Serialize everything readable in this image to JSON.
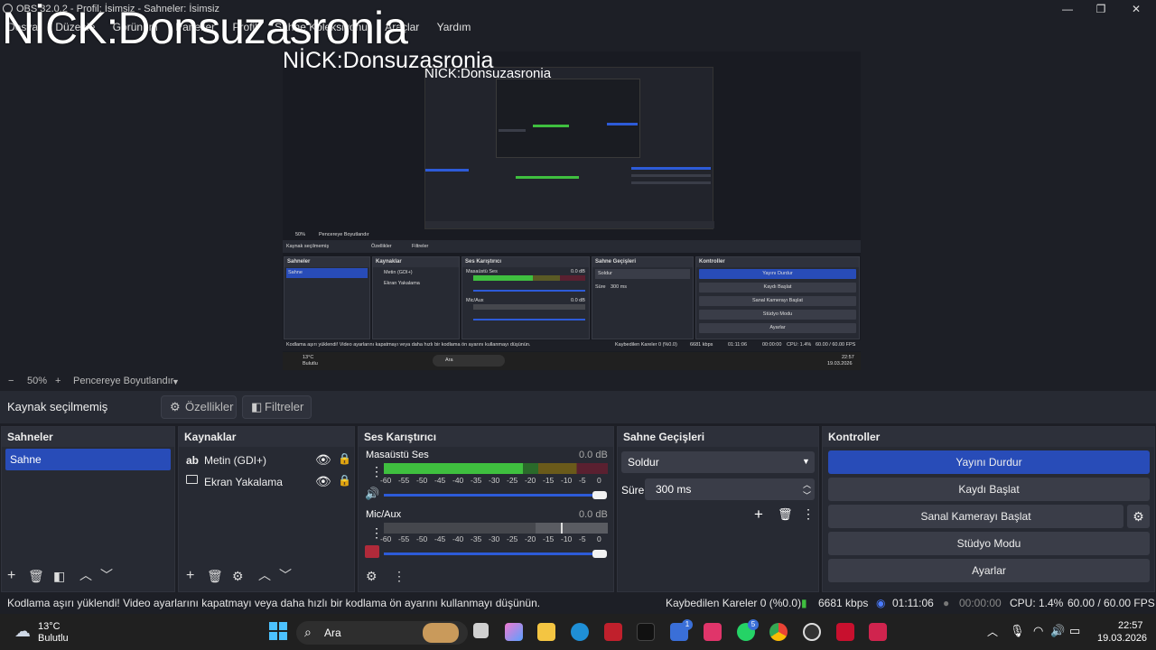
{
  "window": {
    "title": "OBS 32.0.2 - Profil: İsimsiz - Sahneler: İsimsiz",
    "minimize": "—",
    "maximize": "❐",
    "close": "✕"
  },
  "menu": [
    "Dosya",
    "Düzenle",
    "Görünüm",
    "Paneller",
    "Profil",
    "Sahne Koleksiyonu",
    "Araçlar",
    "Yardım"
  ],
  "overlay": {
    "nick": "NİCK:Donsuzasronia"
  },
  "preview": {
    "mini": {
      "zoom": "50%",
      "fit": "Pencereye Boyutlandır",
      "source_status": "Kaynak seçilmemiş",
      "properties": "Özellikler",
      "filters": "Filtreler",
      "scenes": "Sahneler",
      "scene": "Sahne",
      "sources": "Kaynaklar",
      "src1": "Metin (GDI+)",
      "src2": "Ekran Yakalama",
      "mixer": "Ses Karıştırıcı",
      "desktop": "Masaüstü Ses",
      "mic": "Mic/Aux",
      "db": "0.0 dB",
      "transitions": "Sahne Geçişleri",
      "fade": "Soldur",
      "duration_label": "Süre",
      "duration": "300 ms",
      "controls": "Kontroller",
      "b1": "Yayını Durdur",
      "b2": "Kaydı Başlat",
      "b3": "Sanal Kamerayı Başlat",
      "b4": "Stüdyo Modu",
      "b5": "Ayarlar",
      "warning": "Kodlama aşırı yüklendi! Video ayarlarını kapatmayı veya daha hızlı bir kodlama ön ayarını kullanmayı düşünün.",
      "dropped": "Kaybedilen Kareler 0 (%0.0)",
      "kbps": "6681 kbps",
      "time": "01:11:06",
      "rec": "00:00:00",
      "cpu": "CPU: 1.4%",
      "fps": "60.00 / 60.00 FPS",
      "temp": "13°C",
      "weather": "Bulutlu",
      "search": "Ara",
      "clock": "22:57",
      "date": "19.03.2026"
    }
  },
  "zoombar": {
    "minus": "−",
    "zoom": "50%",
    "plus": "+",
    "fit": "Pencereye Boyutlandır"
  },
  "source_toolbar": {
    "status": "Kaynak seçilmemiş",
    "properties": "Özellikler",
    "filters": "Filtreler"
  },
  "scenes": {
    "title": "Sahneler",
    "items": [
      "Sahne"
    ]
  },
  "sources": {
    "title": "Kaynaklar",
    "items": [
      {
        "label": "Metin (GDI+)"
      },
      {
        "label": "Ekran Yakalama"
      }
    ]
  },
  "mixer": {
    "title": "Ses Karıştırıcı",
    "channels": [
      {
        "name": "Masaüstü Ses",
        "db": "0.0 dB",
        "level": 0.62
      },
      {
        "name": "Mic/Aux",
        "db": "0.0 dB",
        "level": 0.0
      }
    ],
    "ticks": [
      "-60",
      "-55",
      "-50",
      "-45",
      "-40",
      "-35",
      "-30",
      "-25",
      "-20",
      "-15",
      "-10",
      "-5",
      "0"
    ]
  },
  "transitions": {
    "title": "Sahne Geçişleri",
    "selected": "Soldur",
    "duration_label": "Süre",
    "duration": "300 ms"
  },
  "controls": {
    "title": "Kontroller",
    "stream": "Yayını Durdur",
    "record": "Kaydı Başlat",
    "virtualcam": "Sanal Kamerayı Başlat",
    "studio": "Stüdyo Modu",
    "settings": "Ayarlar"
  },
  "status": {
    "warning": "Kodlama aşırı yüklendi! Video ayarlarını kapatmayı veya daha hızlı bir kodlama ön ayarını kullanmayı düşünün.",
    "dropped": "Kaybedilen Kareler 0 (%0.0)",
    "kbps": "6681 kbps",
    "stream_time": "01:11:06",
    "rec_time": "00:00:00",
    "cpu": "CPU: 1.4%",
    "fps": "60.00 / 60.00 FPS"
  },
  "taskbar": {
    "temp": "13°C",
    "weather": "Bulutlu",
    "search": "Ara",
    "clock": "22:57",
    "date": "19.03.2026",
    "badge1": "1",
    "badge2": "5"
  },
  "colors": {
    "accent": "#284cb8",
    "panel": "#272a33",
    "bg": "#1d1f26",
    "meter_green": "#3fbf3f",
    "meter_yellow": "#c8a020",
    "meter_red": "#a02030"
  }
}
